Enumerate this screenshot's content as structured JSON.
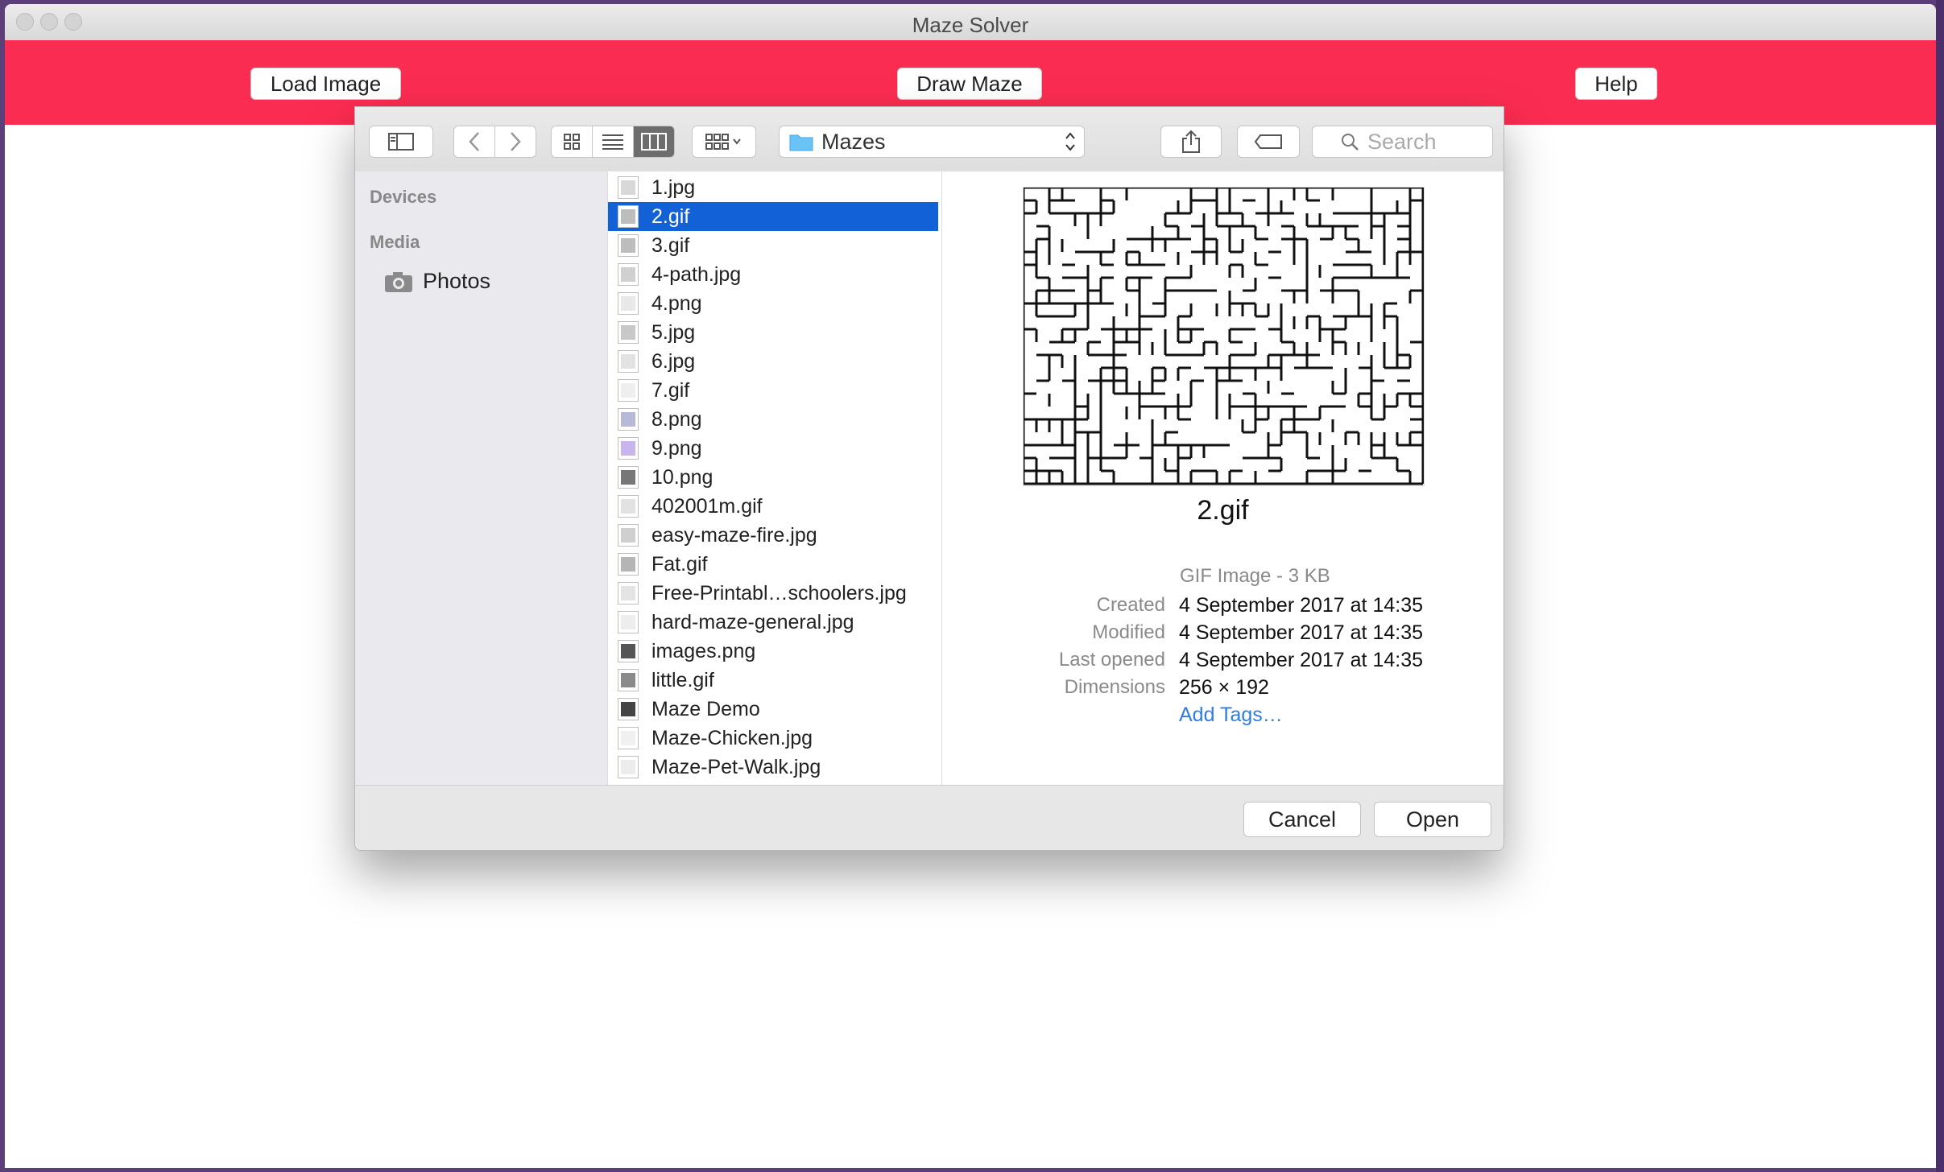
{
  "window": {
    "title": "Maze Solver"
  },
  "app_toolbar": {
    "load_image": "Load Image",
    "draw_maze": "Draw Maze",
    "help": "Help"
  },
  "dialog": {
    "location": "Mazes",
    "search_placeholder": "Search",
    "sidebar": {
      "devices_heading": "Devices",
      "media_heading": "Media",
      "items": [
        {
          "label": "Photos",
          "icon": "camera-icon"
        }
      ]
    },
    "files": [
      {
        "name": "1.jpg",
        "color": "#d8d8d8"
      },
      {
        "name": "2.gif",
        "color": "#bdbdbd",
        "selected": true
      },
      {
        "name": "3.gif",
        "color": "#bdbdbd"
      },
      {
        "name": "4-path.jpg",
        "color": "#d0d0d0"
      },
      {
        "name": "4.png",
        "color": "#e8e8e8"
      },
      {
        "name": "5.jpg",
        "color": "#c8c8c8"
      },
      {
        "name": "6.jpg",
        "color": "#e2e2e2"
      },
      {
        "name": "7.gif",
        "color": "#eeeeee"
      },
      {
        "name": "8.png",
        "color": "#b8b8d8"
      },
      {
        "name": "9.png",
        "color": "#c9b5ee"
      },
      {
        "name": "10.png",
        "color": "#777777"
      },
      {
        "name": "402001m.gif",
        "color": "#e2e2e2"
      },
      {
        "name": "easy-maze-fire.jpg",
        "color": "#cfcfcf"
      },
      {
        "name": "Fat.gif",
        "color": "#b5b5b5"
      },
      {
        "name": "Free-Printabl…schoolers.jpg",
        "color": "#e4e4e4"
      },
      {
        "name": "hard-maze-general.jpg",
        "color": "#ededed"
      },
      {
        "name": "images.png",
        "color": "#555555"
      },
      {
        "name": "little.gif",
        "color": "#8a8a8a"
      },
      {
        "name": "Maze Demo",
        "color": "#444444"
      },
      {
        "name": "Maze-Chicken.jpg",
        "color": "#f0f0f0"
      },
      {
        "name": "Maze-Pet-Walk.jpg",
        "color": "#ececec"
      }
    ],
    "preview": {
      "name": "2.gif",
      "kind": "GIF Image - 3 KB",
      "created_label": "Created",
      "created": "4 September 2017 at 14:35",
      "modified_label": "Modified",
      "modified": "4 September 2017 at 14:35",
      "last_opened_label": "Last opened",
      "last_opened": "4 September 2017 at 14:35",
      "dimensions_label": "Dimensions",
      "dimensions": "256 × 192",
      "add_tags": "Add Tags…"
    },
    "buttons": {
      "cancel": "Cancel",
      "open": "Open"
    }
  },
  "colors": {
    "accent_bar": "#fb2c51",
    "selection": "#1361d6",
    "link": "#2f7ce6"
  }
}
